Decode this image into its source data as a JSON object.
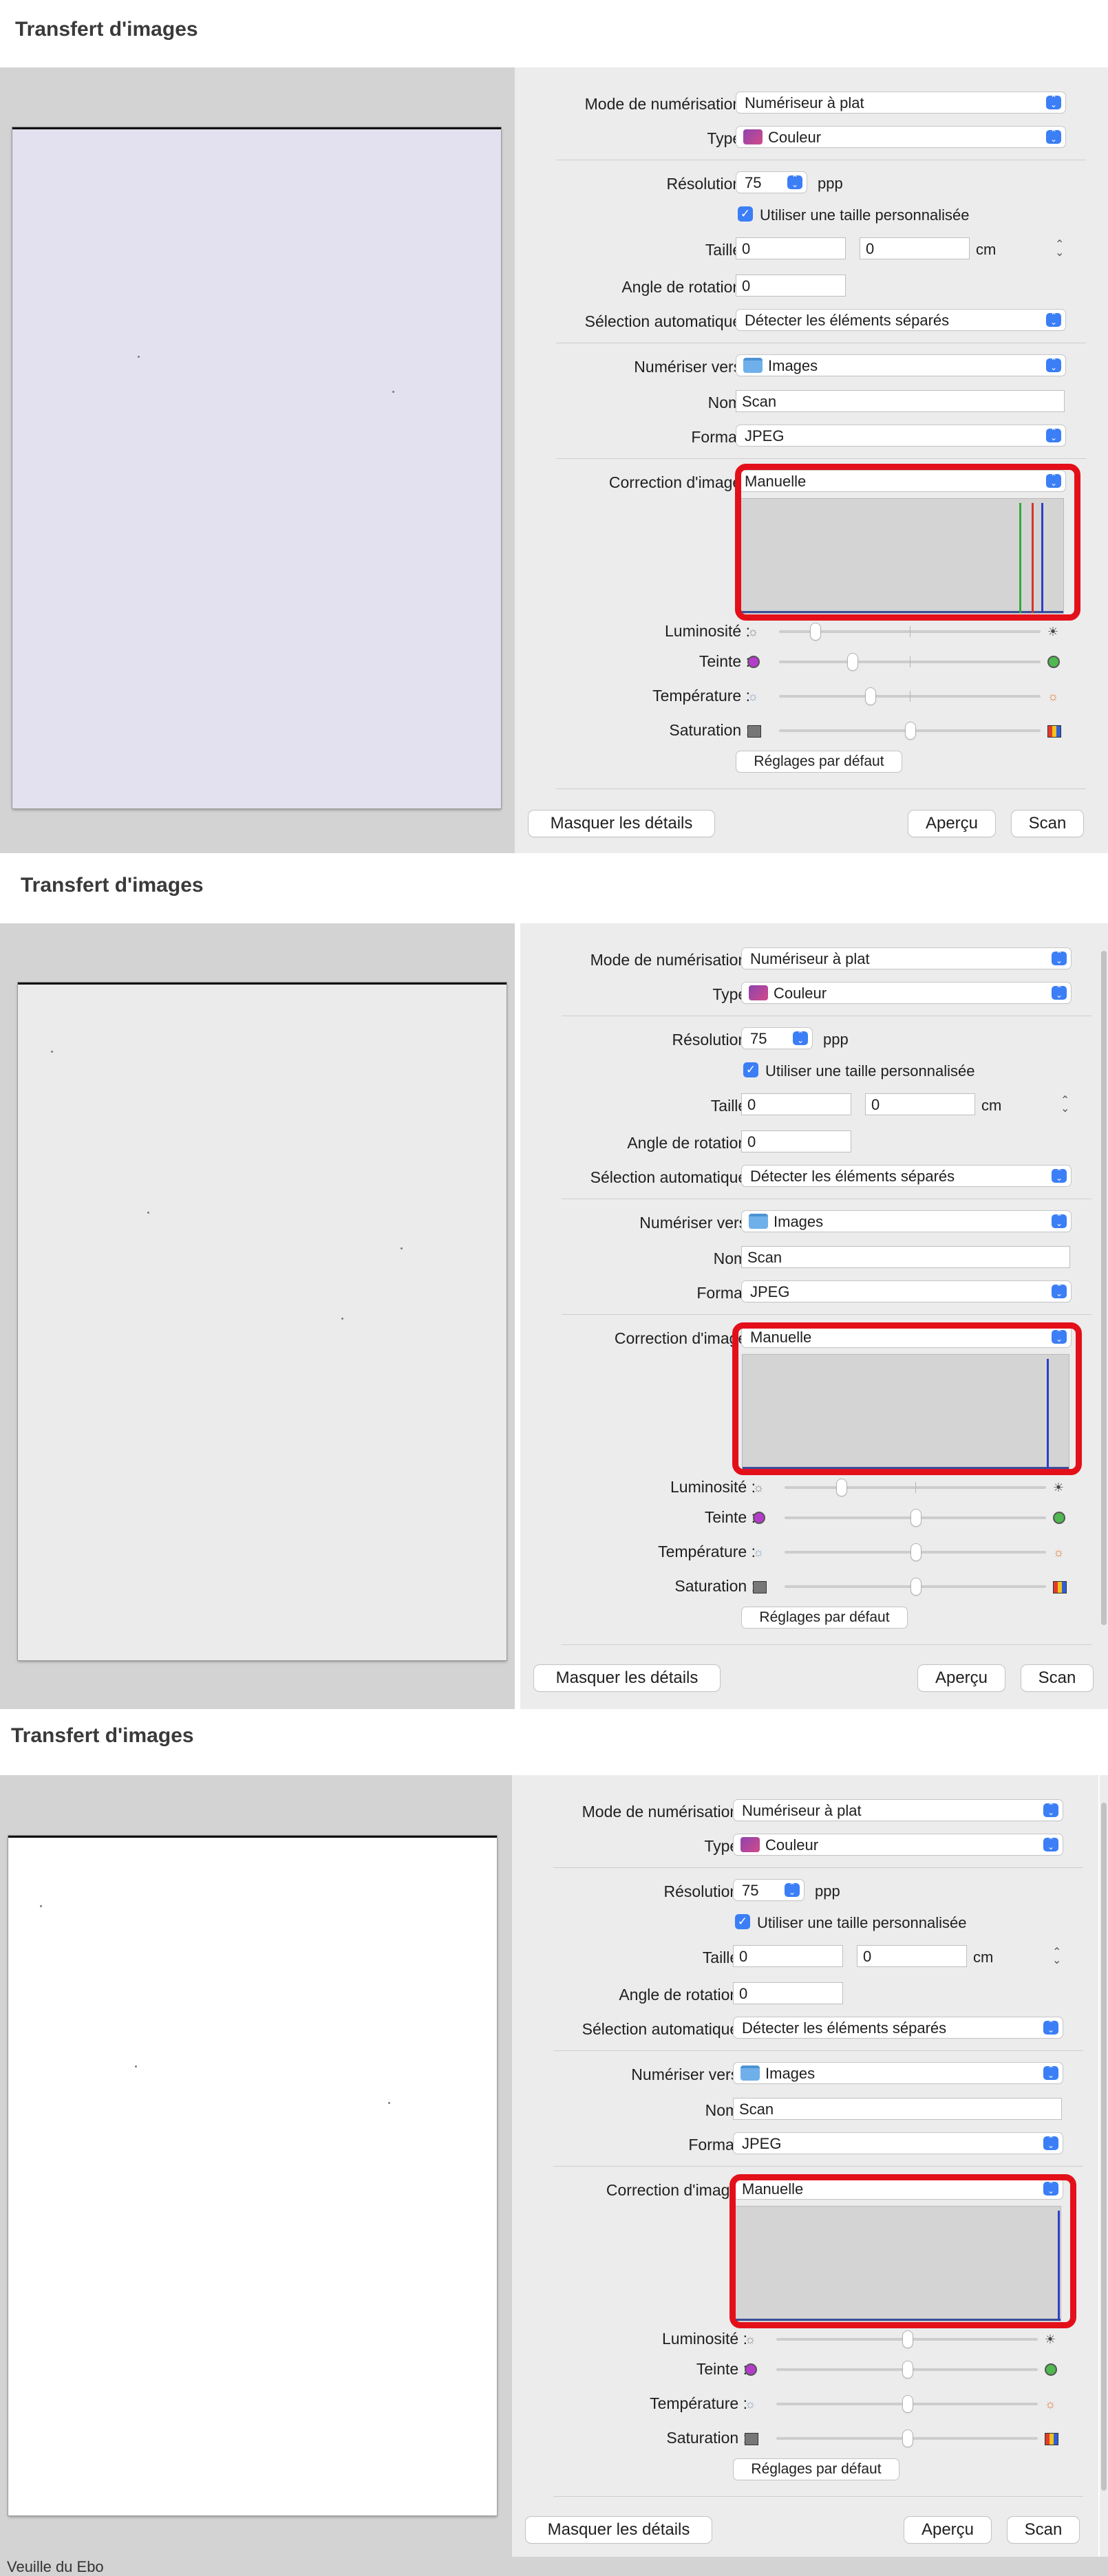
{
  "window_title": "Transfert d'images",
  "labels": {
    "mode": "Mode de numérisation :",
    "type": "Type :",
    "resolution": "Résolution :",
    "size": "Taille :",
    "rotation": "Angle de rotation :",
    "autoselect": "Sélection automatique :",
    "scan_to": "Numériser vers :",
    "name": "Nom :",
    "format": "Format :",
    "correction": "Correction d'image :",
    "brightness": "Luminosité :",
    "tint": "Teinte :",
    "temperature": "Température :",
    "saturation": "Saturation :"
  },
  "values": {
    "mode": "Numériseur à plat",
    "type": "Couleur",
    "resolution": "75",
    "resolution_unit": "ppp",
    "custom_size_label": "Utiliser une taille personnalisée",
    "custom_size_checked": true,
    "width": "0",
    "height": "0",
    "size_unit": "cm",
    "rotation": "0",
    "autoselect": "Détecter les éléments séparés",
    "scan_to": "Images",
    "name": "Scan",
    "format": "JPEG",
    "correction": "Manuelle"
  },
  "buttons": {
    "defaults": "Réglages par défaut",
    "hide_details": "Masquer les détails",
    "preview": "Aperçu",
    "scan": "Scan"
  },
  "icons": {
    "type": "photo-color-icon",
    "scan_to": "folder-icon",
    "brightness_low": "sun-dim-icon",
    "brightness_high": "sun-bright-icon",
    "tint_low": "magenta-dot-icon",
    "tint_high": "green-dot-icon",
    "temperature_low": "cool-sun-icon",
    "temperature_high": "warm-sun-icon",
    "saturation_low": "grey-swatch-icon",
    "saturation_high": "color-swatch-icon"
  },
  "screens": [
    {
      "paper_color": "#e3e0ef",
      "sliders": {
        "brightness": 0.14,
        "tint": 0.27,
        "temperature": 0.33,
        "saturation": 0.48
      },
      "histogram": "rgb-spikes"
    },
    {
      "paper_color": "#ebebeb",
      "sliders": {
        "brightness": 0.22,
        "tint": 0.48,
        "temperature": 0.48,
        "saturation": 0.48
      },
      "histogram": "blue-spike"
    },
    {
      "paper_color": "#ffffff",
      "sliders": {
        "brightness": 0.48,
        "tint": 0.48,
        "temperature": 0.48,
        "saturation": 0.48
      },
      "histogram": "edge-spike"
    }
  ],
  "colors": {
    "accent": "#3b7ef6",
    "highlight_box": "#e3101a"
  },
  "partial_text_bottom": "Veuille du Ebo"
}
